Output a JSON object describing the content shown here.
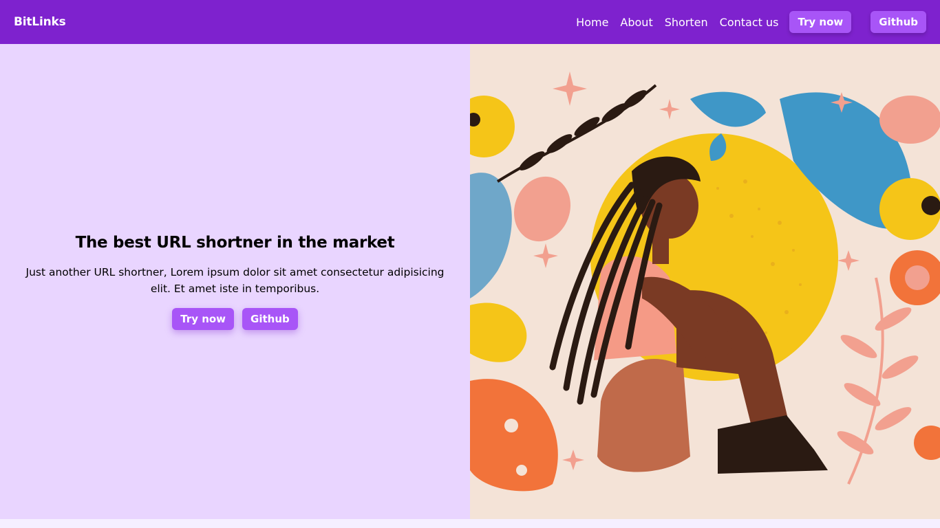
{
  "navbar": {
    "brand": "BitLinks",
    "links": [
      "Home",
      "About",
      "Shorten",
      "Contact us"
    ],
    "try_now": "Try now",
    "github": "Github",
    "background": "#7e22ce"
  },
  "hero": {
    "title": "The best URL shortner in the market",
    "description": "Just another URL shortner, Lorem ipsum dolor sit amet consectetur adipisicing elit. Et amet iste in temporibus.",
    "try_now": "Try now",
    "github": "Github",
    "left_background": "#e9d5ff",
    "button_color": "#a855f7",
    "illustration": "woman-sitting-with-flowers-illustration"
  }
}
